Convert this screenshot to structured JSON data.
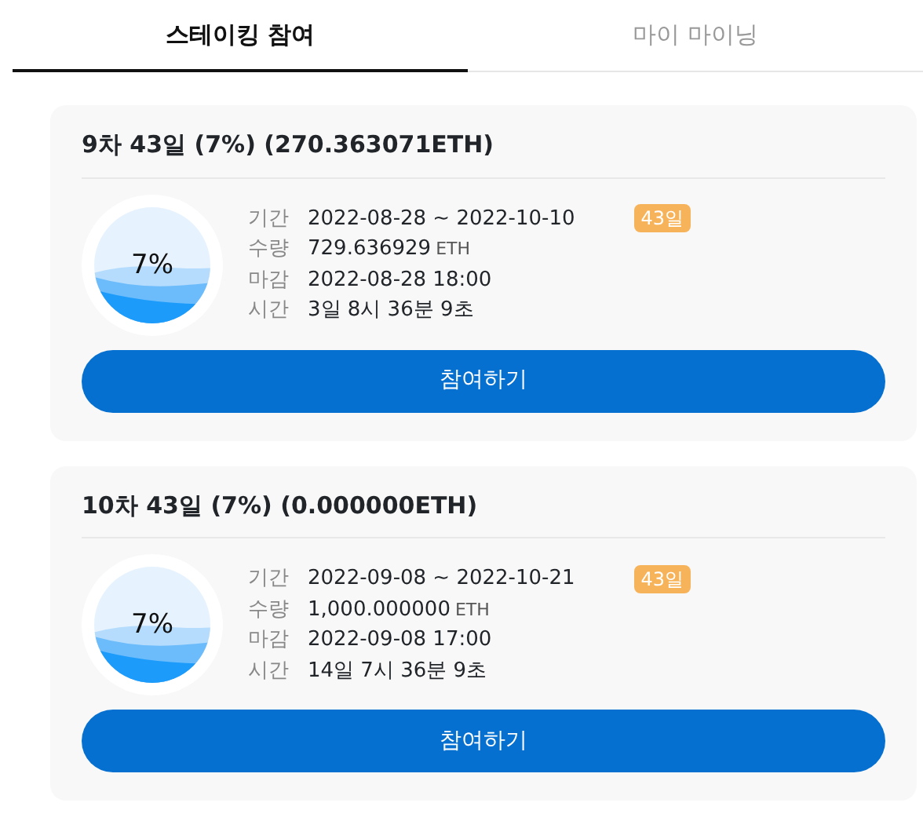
{
  "tabs": [
    {
      "label": "스테이킹 참여",
      "selected": true
    },
    {
      "label": "마이 마이닝",
      "selected": false
    }
  ],
  "stakes": [
    {
      "title": "9차 43일 (7%) (270.363071ETH)",
      "gauge": "7%",
      "badge": "43일",
      "rows": [
        {
          "label": "기간",
          "value": "2022-08-28 ~ 2022-10-10"
        },
        {
          "label": "수량",
          "value": "729.636929",
          "unit": "ETH"
        },
        {
          "label": "마감",
          "value": "2022-08-28 18:00"
        },
        {
          "label": "시간",
          "value": "3일 8시 36분 9초"
        }
      ],
      "button": "참여하기"
    },
    {
      "title": "10차 43일 (7%) (0.000000ETH)",
      "gauge": "7%",
      "badge": "43일",
      "rows": [
        {
          "label": "기간",
          "value": "2022-09-08 ~ 2022-10-21"
        },
        {
          "label": "수량",
          "value": "1,000.000000",
          "unit": "ETH"
        },
        {
          "label": "마감",
          "value": "2022-09-08 17:00"
        },
        {
          "label": "시간",
          "value": "14일 7시 36분 9초"
        }
      ],
      "button": "참여하기"
    }
  ]
}
